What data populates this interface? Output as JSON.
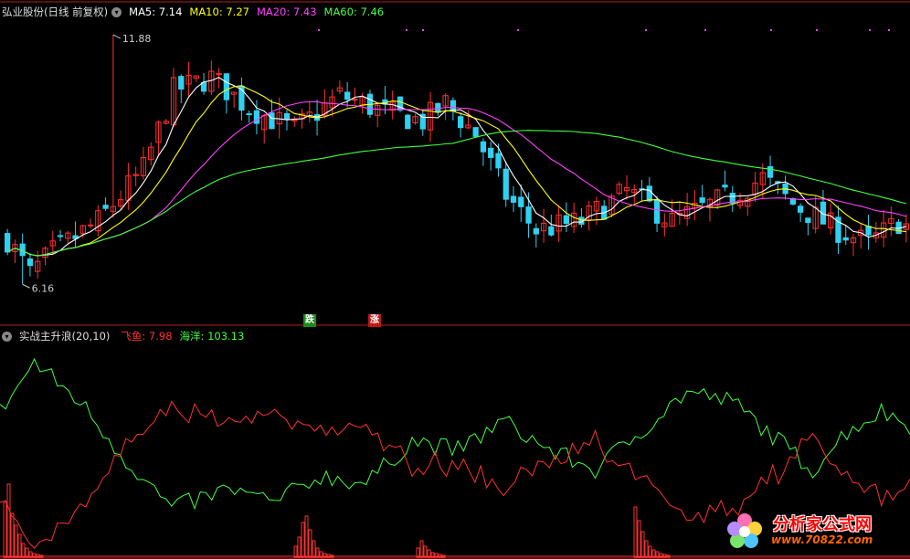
{
  "header_top": {
    "title": "弘业股份(日线 前复权)",
    "ma5": "MA5: 7.14",
    "ma10": "MA10: 7.27",
    "ma20": "MA20: 7.43",
    "ma60": "MA60: 7.46",
    "colors": {
      "ma5": "#ffffff",
      "ma10": "#ffff00",
      "ma20": "#ff40ff",
      "ma60": "#40ff40"
    }
  },
  "header_bottom": {
    "title": "实战主升浪(20,10)",
    "feiyu": "飞鱼: 7.98",
    "haiyang": "海洋: 103.13",
    "colors": {
      "feiyu": "#ff3030",
      "haiyang": "#40ff40"
    }
  },
  "price_labels": {
    "high": "11.88",
    "low": "6.16"
  },
  "badges": {
    "die": "跌",
    "zhang": "涨"
  },
  "watermark": {
    "name": "分析家公式网",
    "url": "www.70822.com"
  },
  "chart_data": [
    {
      "type": "candlestick",
      "title": "弘业股份(日线 前复权)",
      "ylim": [
        5.6,
        12.3
      ],
      "price_high": 11.88,
      "price_low": 6.16,
      "series": [
        {
          "name": "MA5",
          "color": "#ffffff"
        },
        {
          "name": "MA10",
          "color": "#ffff00"
        },
        {
          "name": "MA20",
          "color": "#ff40ff"
        },
        {
          "name": "MA60",
          "color": "#40ff40"
        }
      ],
      "ma_last": {
        "MA5": 7.14,
        "MA10": 7.27,
        "MA20": 7.43,
        "MA60": 7.46
      },
      "n_bars": 120
    },
    {
      "type": "line",
      "title": "实战主升浪(20,10)",
      "series": [
        {
          "name": "飞鱼",
          "color": "#ff3030",
          "last": 7.98
        },
        {
          "name": "海洋",
          "color": "#40ff40",
          "last": 103.13
        }
      ],
      "ylim": [
        0,
        110
      ]
    }
  ]
}
